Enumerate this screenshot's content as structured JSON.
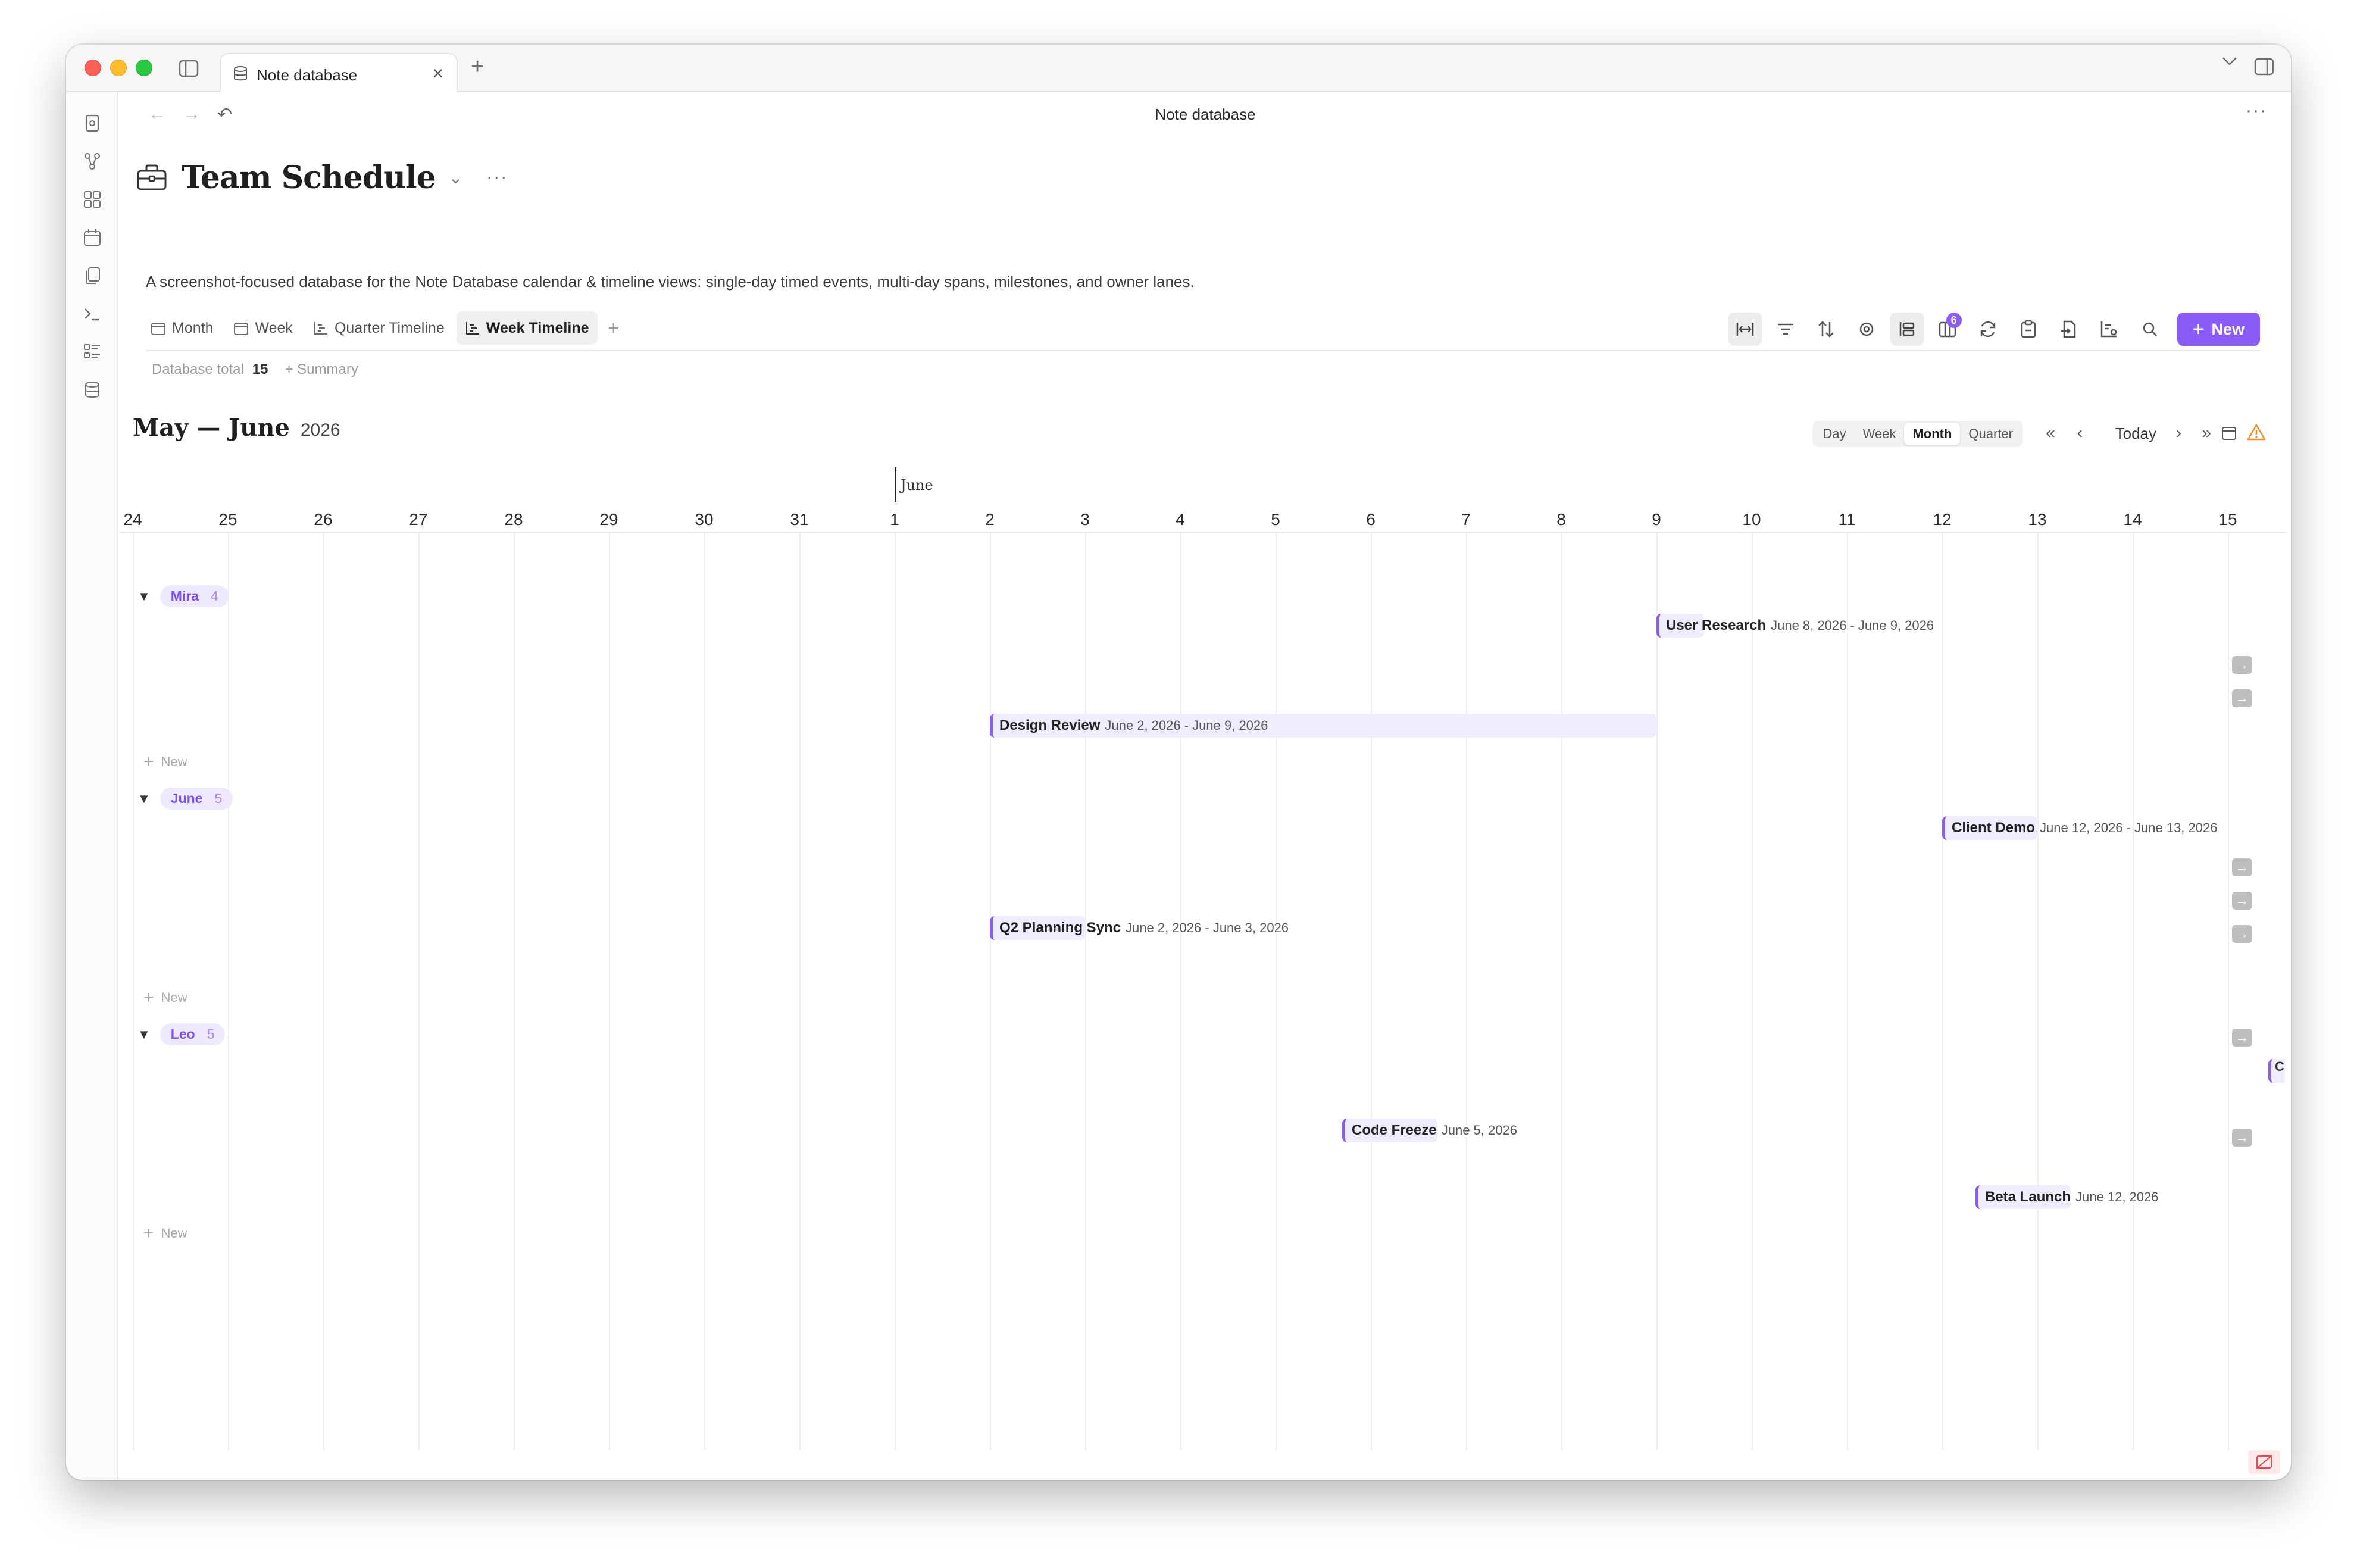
{
  "window": {
    "tab_title": "Note database",
    "view_title": "Note database"
  },
  "database": {
    "title": "Team Schedule",
    "description": "A screenshot-focused database for the Note Database calendar & timeline views: single-day timed events, multi-day spans, milestones, and owner lanes.",
    "views": [
      {
        "label": "Month",
        "icon": "calendar-icon"
      },
      {
        "label": "Week",
        "icon": "calendar-icon"
      },
      {
        "label": "Quarter Timeline",
        "icon": "timeline-icon"
      },
      {
        "label": "Week Timeline",
        "icon": "timeline-icon",
        "active": true
      }
    ],
    "summary": {
      "label": "Database total",
      "count": "15",
      "add_label": "+ Summary"
    },
    "new_button": "New",
    "column_badge": "6"
  },
  "calendar": {
    "range_title": "May — June",
    "year": "2026",
    "zoom_options": [
      "Day",
      "Week",
      "Month",
      "Quarter"
    ],
    "zoom_active": "Month",
    "today_label": "Today",
    "month_marker": "June",
    "days": [
      "24",
      "25",
      "26",
      "27",
      "28",
      "29",
      "30",
      "31",
      "1",
      "2",
      "3",
      "4",
      "5",
      "6",
      "7",
      "8",
      "9",
      "10",
      "11",
      "12",
      "13",
      "14",
      "15"
    ]
  },
  "groups": [
    {
      "name": "Mira",
      "count": "4",
      "new_label": "New",
      "events": [
        {
          "name": "User Research",
          "dates": "June 8, 2026 - June 9, 2026"
        },
        {
          "name": "Design Review",
          "dates": "June 2, 2026 - June 9, 2026"
        }
      ]
    },
    {
      "name": "June",
      "count": "5",
      "new_label": "New",
      "events": [
        {
          "name": "Client Demo",
          "dates": "June 12, 2026 - June 13, 2026"
        },
        {
          "name": "Q2 Planning Sync",
          "dates": "June 2, 2026 - June 3, 2026"
        }
      ]
    },
    {
      "name": "Leo",
      "count": "5",
      "new_label": "New",
      "events": [
        {
          "name": "Code Freeze",
          "dates": "June 5, 2026"
        },
        {
          "name": "Beta Launch",
          "dates": "June 12, 2026"
        }
      ],
      "edge_event_initial": "C"
    }
  ],
  "colors": {
    "accent": "#8a5cf5",
    "event_bg": "#f1ecfd",
    "warning": "#f08a24"
  }
}
